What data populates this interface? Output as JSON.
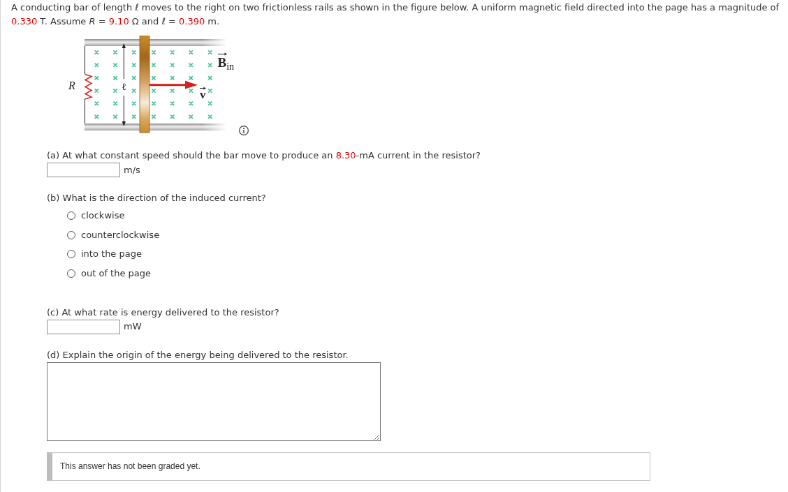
{
  "problem": {
    "segments": [
      {
        "kind": "text",
        "text": "A conducting bar of length ℓ moves to the right on two frictionless rails as shown in the figure below. A uniform magnetic field directed into the page has a magnitude of "
      },
      {
        "kind": "given",
        "text": "0.330"
      },
      {
        "kind": "text",
        "text": " T. Assume *R* = "
      },
      {
        "kind": "given",
        "text": "9.10"
      },
      {
        "kind": "text",
        "text": " Ω and ℓ = "
      },
      {
        "kind": "given",
        "text": "0.390"
      },
      {
        "kind": "text",
        "text": " m."
      }
    ]
  },
  "figure": {
    "labels": [
      {
        "kind": "resistor",
        "text": "R"
      },
      {
        "kind": "length",
        "text": "ℓ"
      },
      {
        "kind": "velocity",
        "text": "v"
      },
      {
        "kind": "field",
        "text": "**B**$_{in}$"
      }
    ]
  },
  "parts": [
    {
      "kind": "numeric",
      "question": [
        {
          "kind": "text",
          "text": "(a) At what constant speed should the bar move to produce an "
        },
        {
          "kind": "given",
          "text": "8.30"
        },
        {
          "kind": "text",
          "text": "-mA current in the resistor?"
        }
      ],
      "unit": "m/s"
    },
    {
      "kind": "choice",
      "question": [
        {
          "kind": "text",
          "text": "(b) What is the direction of the induced current?"
        }
      ],
      "options": [
        {
          "label": "clockwise",
          "selected": false
        },
        {
          "label": "counterclockwise",
          "selected": false
        },
        {
          "label": "into the page",
          "selected": false
        },
        {
          "label": "out of the page",
          "selected": false
        }
      ]
    },
    {
      "kind": "numeric",
      "question": [
        {
          "kind": "text",
          "text": "(c) At what rate is energy delivered to the resistor?"
        }
      ],
      "unit": "mW"
    },
    {
      "kind": "essay",
      "question": [
        {
          "kind": "text",
          "text": "(d) Explain the origin of the energy being delivered to the resistor."
        }
      ]
    }
  ],
  "feedback": {
    "text": "This answer has not been graded yet."
  }
}
